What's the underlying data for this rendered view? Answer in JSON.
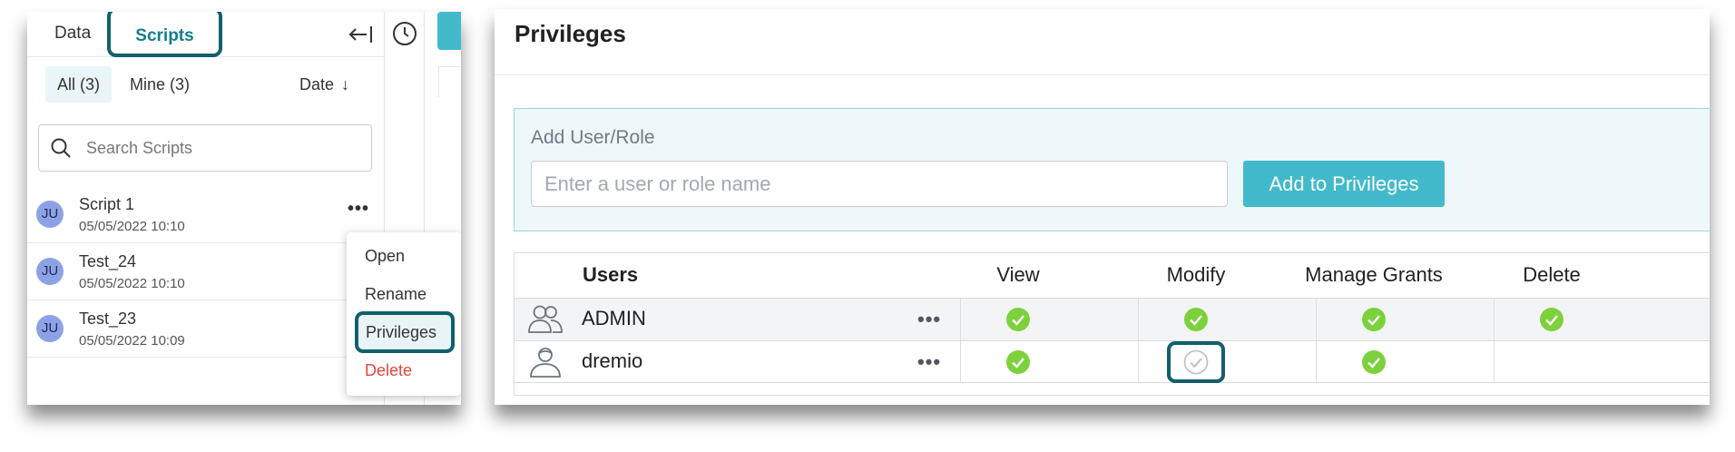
{
  "left_panel": {
    "tabs": {
      "data": "Data",
      "scripts": "Scripts"
    },
    "filters": {
      "all": "All (3)",
      "mine": "Mine (3)",
      "sort": "Date",
      "sort_arrow": "↓"
    },
    "search": {
      "placeholder": "Search Scripts"
    },
    "scripts": [
      {
        "avatar": "JU",
        "name": "Script 1",
        "date": "05/05/2022 10:10"
      },
      {
        "avatar": "JU",
        "name": "Test_24",
        "date": "05/05/2022 10:10"
      },
      {
        "avatar": "JU",
        "name": "Test_23",
        "date": "05/05/2022 10:09"
      }
    ],
    "more_glyph": "•••",
    "context_menu": {
      "open": "Open",
      "rename": "Rename",
      "privileges": "Privileges",
      "delete": "Delete"
    }
  },
  "right_panel": {
    "title": "Privileges",
    "add": {
      "label": "Add User/Role",
      "placeholder": "Enter a user or role name",
      "button": "Add to Privileges"
    },
    "table": {
      "headers": [
        "Users",
        "View",
        "Modify",
        "Manage Grants",
        "Delete"
      ],
      "rows": [
        {
          "name": "ADMIN",
          "icon": "group-icon",
          "view": true,
          "modify": true,
          "manage_grants": true,
          "delete": true
        },
        {
          "name": "dremio",
          "icon": "user-icon",
          "view": true,
          "modify": false,
          "manage_grants": true,
          "delete": false
        }
      ],
      "more_glyph": "•••"
    }
  },
  "colors": {
    "accent": "#43bacb",
    "highlight_outline": "#125f6e",
    "check_green": "#7dd13c",
    "danger": "#e2473a"
  }
}
